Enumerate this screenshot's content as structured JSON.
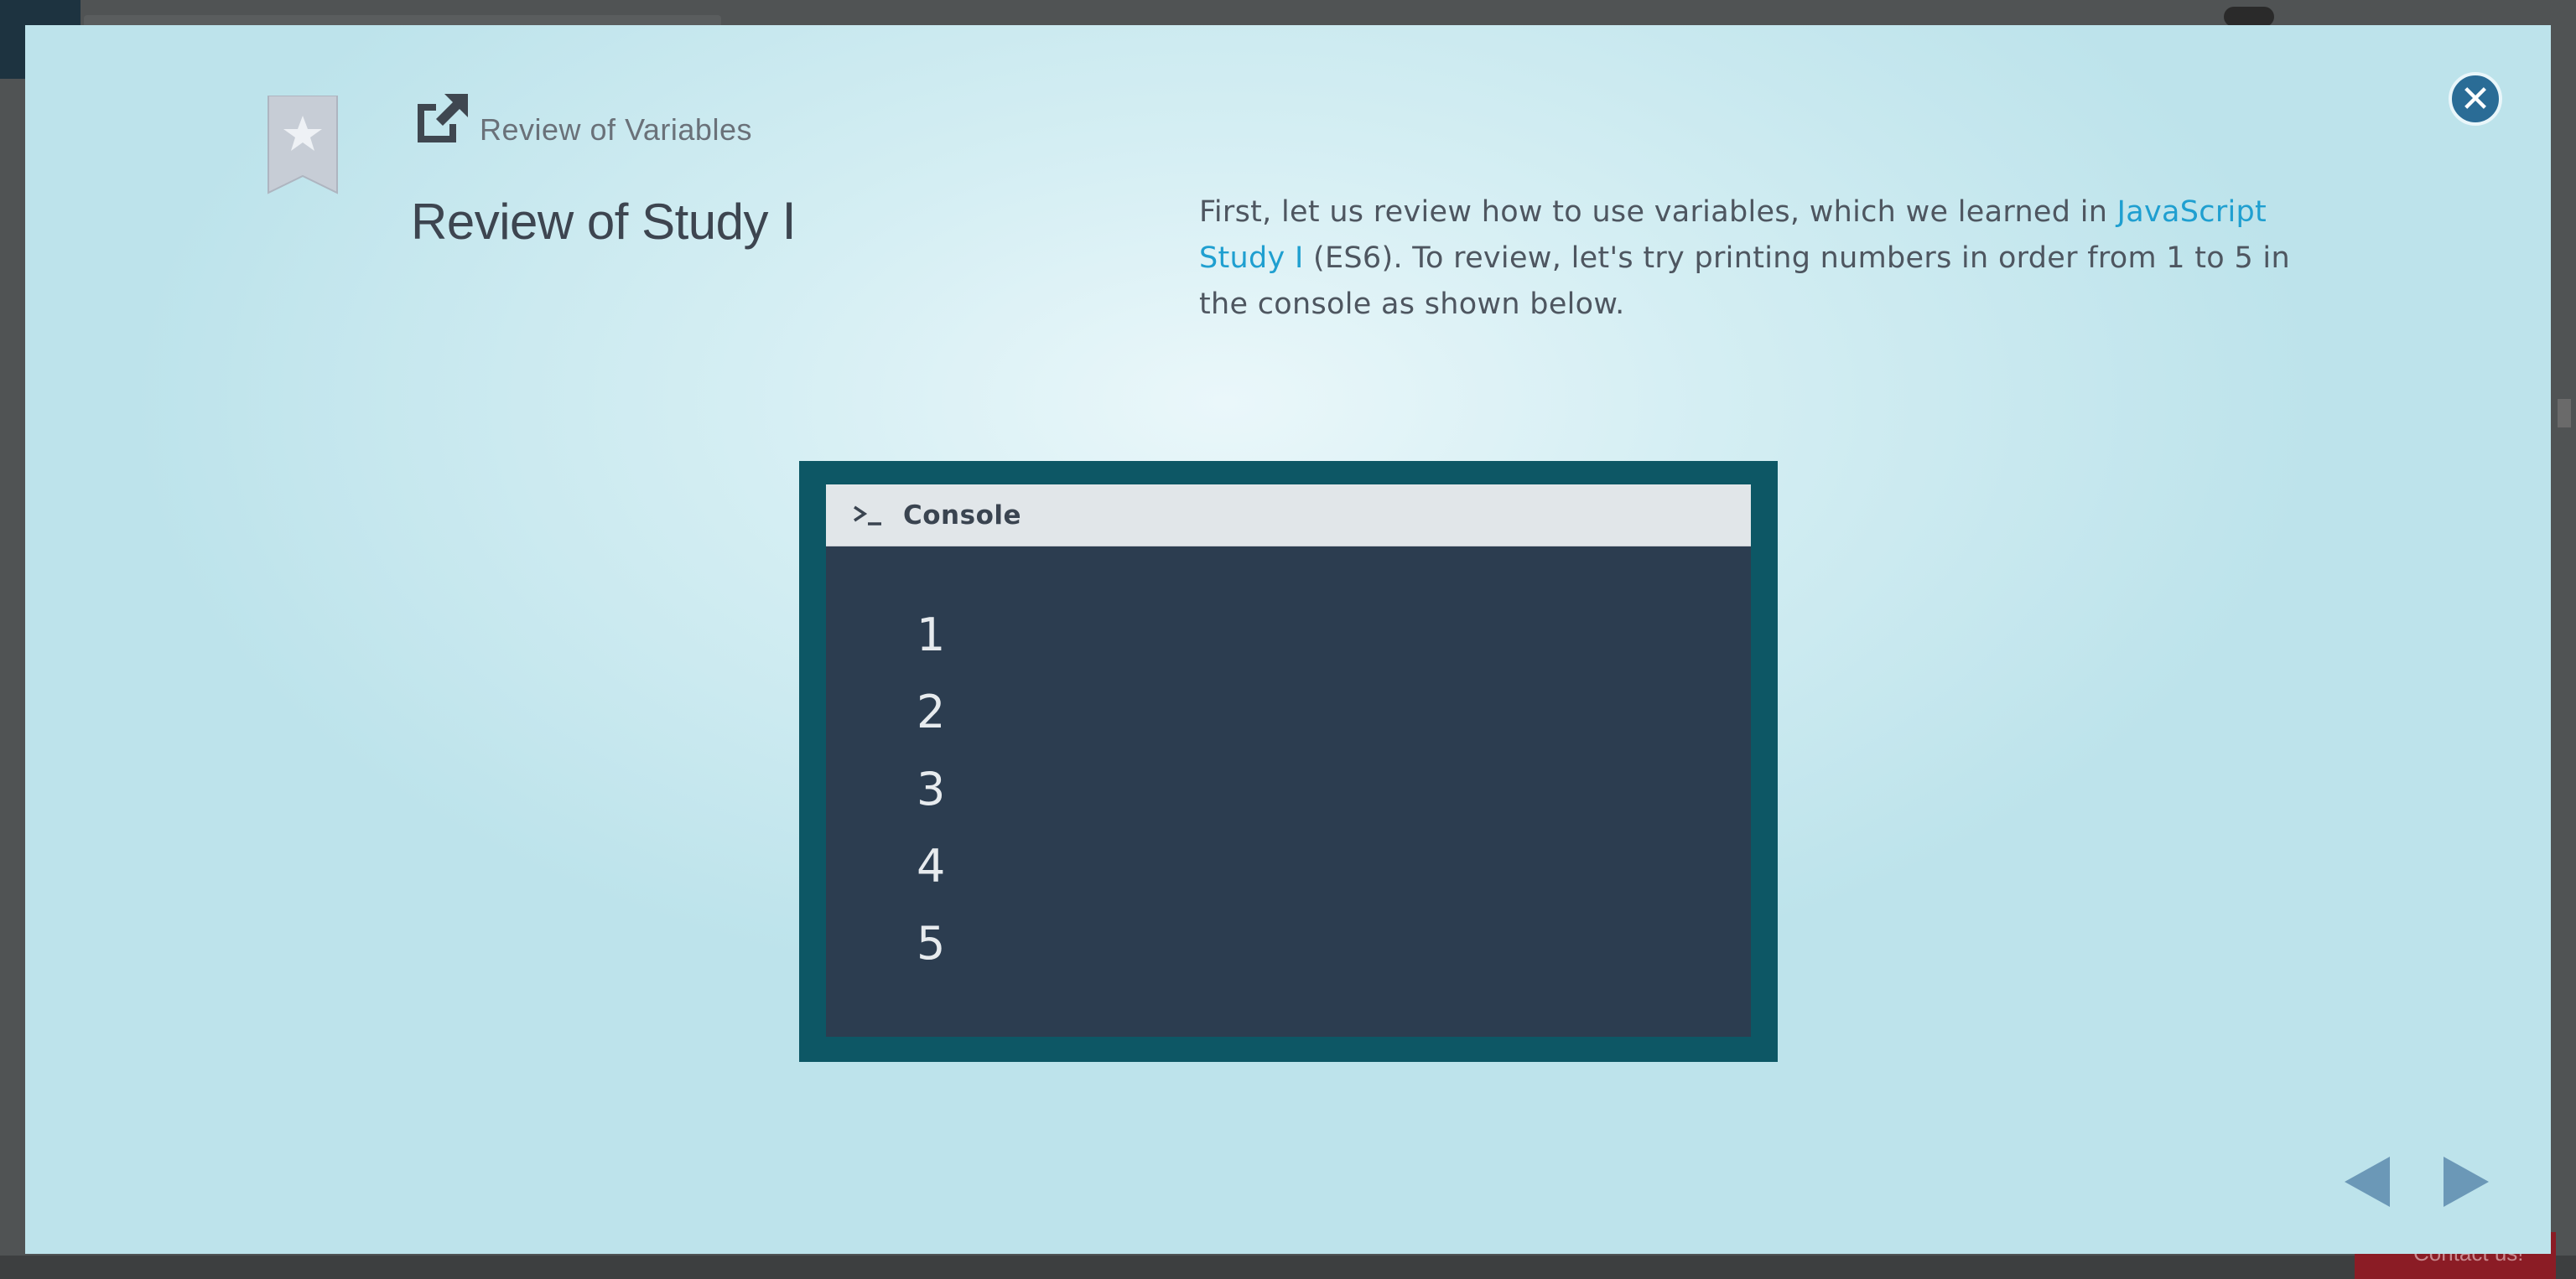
{
  "modal": {
    "subtitle": "Review of Variables",
    "title": "Review of Study Ⅰ",
    "description": {
      "part1": "First, let us review how to use variables, which we learned in ",
      "link": "JavaScript Study I",
      "part2": " (ES6). To review, let's try printing numbers in order from 1 to 5 in the console as shown below."
    },
    "close_icon": "close-icon",
    "colors": {
      "accent": "#2a6c96",
      "link": "#1f9fd0",
      "console_frame": "#0d5765",
      "console_bg": "#2c3d50"
    }
  },
  "console": {
    "title": "Console",
    "lines": [
      "1",
      "2",
      "3",
      "4",
      "5"
    ]
  },
  "background": {
    "contact_label": "Contact us!"
  }
}
